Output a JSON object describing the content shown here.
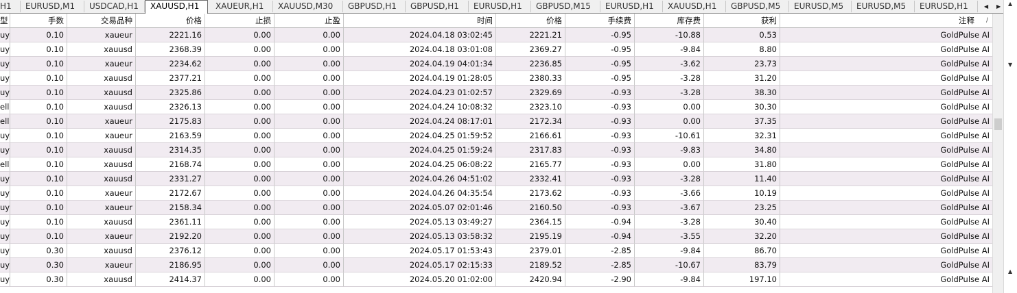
{
  "tabs": [
    {
      "label": "H1",
      "active": false
    },
    {
      "label": "EURUSD,M1",
      "active": false
    },
    {
      "label": "USDCAD,H1",
      "active": false
    },
    {
      "label": "XAUUSD,H1",
      "active": true
    },
    {
      "label": "XAUEUR,H1",
      "active": false
    },
    {
      "label": "XAUUSD,M30",
      "active": false
    },
    {
      "label": "GBPUSD,H1",
      "active": false
    },
    {
      "label": "GBPUSD,H1",
      "active": false
    },
    {
      "label": "EURUSD,H1",
      "active": false
    },
    {
      "label": "GBPUSD,M15",
      "active": false
    },
    {
      "label": "EURUSD,H1",
      "active": false
    },
    {
      "label": "XAUUSD,H1",
      "active": false
    },
    {
      "label": "GBPUSD,M5",
      "active": false
    },
    {
      "label": "EURUSD,M5",
      "active": false
    },
    {
      "label": "EURUSD,M5",
      "active": false
    },
    {
      "label": "EURUSD,H1",
      "active": false
    }
  ],
  "tab_nav": {
    "left": "◀",
    "right": "▶"
  },
  "columns": [
    "型",
    "手数",
    "交易品种",
    "价格",
    "止损",
    "止盈",
    "时间",
    "价格",
    "手续费",
    "库存费",
    "获利",
    "注释"
  ],
  "sort_indicator": "/",
  "rows": [
    [
      "uy",
      "0.10",
      "xaueur",
      "2221.16",
      "0.00",
      "0.00",
      "2024.04.18 03:02:45",
      "2221.21",
      "-0.95",
      "-10.88",
      "0.53",
      "GoldPulse AI"
    ],
    [
      "uy",
      "0.10",
      "xauusd",
      "2368.39",
      "0.00",
      "0.00",
      "2024.04.18 03:01:08",
      "2369.27",
      "-0.95",
      "-9.84",
      "8.80",
      "GoldPulse AI"
    ],
    [
      "uy",
      "0.10",
      "xaueur",
      "2234.62",
      "0.00",
      "0.00",
      "2024.04.19 04:01:34",
      "2236.85",
      "-0.95",
      "-3.62",
      "23.73",
      "GoldPulse AI"
    ],
    [
      "uy",
      "0.10",
      "xauusd",
      "2377.21",
      "0.00",
      "0.00",
      "2024.04.19 01:28:05",
      "2380.33",
      "-0.95",
      "-3.28",
      "31.20",
      "GoldPulse AI"
    ],
    [
      "uy",
      "0.10",
      "xauusd",
      "2325.86",
      "0.00",
      "0.00",
      "2024.04.23 01:02:57",
      "2329.69",
      "-0.93",
      "-3.28",
      "38.30",
      "GoldPulse AI"
    ],
    [
      "ell",
      "0.10",
      "xauusd",
      "2326.13",
      "0.00",
      "0.00",
      "2024.04.24 10:08:32",
      "2323.10",
      "-0.93",
      "0.00",
      "30.30",
      "GoldPulse AI"
    ],
    [
      "ell",
      "0.10",
      "xaueur",
      "2175.83",
      "0.00",
      "0.00",
      "2024.04.24 08:17:01",
      "2172.34",
      "-0.93",
      "0.00",
      "37.35",
      "GoldPulse AI"
    ],
    [
      "uy",
      "0.10",
      "xaueur",
      "2163.59",
      "0.00",
      "0.00",
      "2024.04.25 01:59:52",
      "2166.61",
      "-0.93",
      "-10.61",
      "32.31",
      "GoldPulse AI"
    ],
    [
      "uy",
      "0.10",
      "xauusd",
      "2314.35",
      "0.00",
      "0.00",
      "2024.04.25 01:59:24",
      "2317.83",
      "-0.93",
      "-9.83",
      "34.80",
      "GoldPulse AI"
    ],
    [
      "ell",
      "0.10",
      "xauusd",
      "2168.74",
      "0.00",
      "0.00",
      "2024.04.25 06:08:22",
      "2165.77",
      "-0.93",
      "0.00",
      "31.80",
      "GoldPulse AI"
    ],
    [
      "uy",
      "0.10",
      "xauusd",
      "2331.27",
      "0.00",
      "0.00",
      "2024.04.26 04:51:02",
      "2332.41",
      "-0.93",
      "-3.28",
      "11.40",
      "GoldPulse AI"
    ],
    [
      "uy",
      "0.10",
      "xaueur",
      "2172.67",
      "0.00",
      "0.00",
      "2024.04.26 04:35:54",
      "2173.62",
      "-0.93",
      "-3.66",
      "10.19",
      "GoldPulse AI"
    ],
    [
      "uy",
      "0.10",
      "xaueur",
      "2158.34",
      "0.00",
      "0.00",
      "2024.05.07 02:01:46",
      "2160.50",
      "-0.93",
      "-3.67",
      "23.25",
      "GoldPulse AI"
    ],
    [
      "uy",
      "0.10",
      "xauusd",
      "2361.11",
      "0.00",
      "0.00",
      "2024.05.13 03:49:27",
      "2364.15",
      "-0.94",
      "-3.28",
      "30.40",
      "GoldPulse AI"
    ],
    [
      "uy",
      "0.10",
      "xaueur",
      "2192.20",
      "0.00",
      "0.00",
      "2024.05.13 03:58:32",
      "2195.19",
      "-0.94",
      "-3.55",
      "32.20",
      "GoldPulse AI"
    ],
    [
      "uy",
      "0.30",
      "xauusd",
      "2376.12",
      "0.00",
      "0.00",
      "2024.05.17 01:53:43",
      "2379.01",
      "-2.85",
      "-9.84",
      "86.70",
      "GoldPulse AI"
    ],
    [
      "uy",
      "0.30",
      "xaueur",
      "2186.95",
      "0.00",
      "0.00",
      "2024.05.17 02:15:33",
      "2189.52",
      "-2.85",
      "-10.67",
      "83.79",
      "GoldPulse AI"
    ],
    [
      "uy",
      "0.30",
      "xauusd",
      "2414.37",
      "0.00",
      "0.00",
      "2024.05.20 01:02:00",
      "2420.94",
      "-2.90",
      "-9.84",
      "197.10",
      "GoldPulse AI"
    ]
  ],
  "scroll_arrows": {
    "up": "▲",
    "down": "▼"
  }
}
